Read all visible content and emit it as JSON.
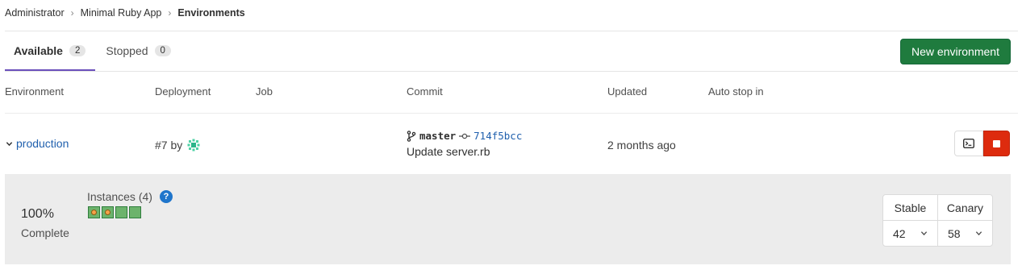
{
  "breadcrumb": {
    "items": [
      "Administrator",
      "Minimal Ruby App"
    ],
    "current": "Environments",
    "separator": "›"
  },
  "tabs": [
    {
      "label": "Available",
      "count": "2",
      "active": true
    },
    {
      "label": "Stopped",
      "count": "0",
      "active": false
    }
  ],
  "actions": {
    "new_environment": "New environment"
  },
  "columns": {
    "environment": "Environment",
    "deployment": "Deployment",
    "job": "Job",
    "commit": "Commit",
    "updated": "Updated",
    "auto_stop": "Auto stop in"
  },
  "environment": {
    "name": "production",
    "deployment": "#7 by",
    "branch": "master",
    "sha": "714f5bcc",
    "commit_title": "Update server.rb",
    "updated": "2 months ago"
  },
  "deploy_board": {
    "percent": "100%",
    "status": "Complete",
    "instances_label": "Instances (4)",
    "help_glyph": "?",
    "instances": [
      {
        "state": "canary"
      },
      {
        "state": "canary"
      },
      {
        "state": "stable"
      },
      {
        "state": "stable"
      }
    ],
    "rollout": {
      "stable_label": "Stable",
      "stable_value": "42",
      "canary_label": "Canary",
      "canary_value": "58"
    }
  },
  "colors": {
    "primary_green": "#1f7b3e",
    "danger_red": "#dd2b0e",
    "link_blue": "#1f5fad",
    "tab_underline": "#6b4fbb",
    "instance_green": "#6cb36c",
    "canary_dot": "#f5a24a"
  },
  "icons": {
    "breadcrumb_separator": "chevron-right-icon",
    "expand": "chevron-down-icon",
    "avatar": "identicon-avatar",
    "branch": "branch-icon",
    "commit": "commit-icon",
    "terminal": "terminal-icon",
    "stop": "stop-icon",
    "help": "question-icon"
  }
}
